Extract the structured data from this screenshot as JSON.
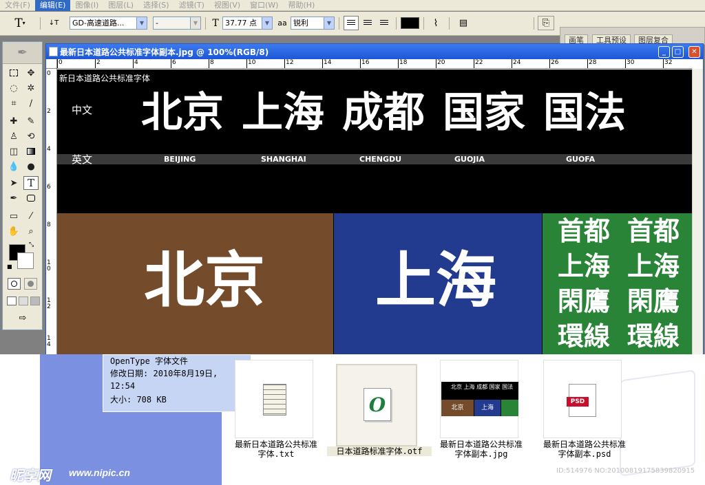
{
  "menubar": {
    "items": [
      "文件(F)",
      "编辑(E)",
      "图像(I)",
      "图层(L)",
      "选择(S)",
      "滤镜(T)",
      "视图(V)",
      "窗口(W)",
      "帮助(H)"
    ],
    "active_index": 1
  },
  "options_bar": {
    "tool_glyph": "T",
    "orient_glyph": "↓T",
    "font_family": "GD-高速道路...",
    "font_style": "-",
    "size_glyph": "T",
    "font_size": "37.77 点",
    "aa_glyph": "aa",
    "aa_mode": "锐利",
    "text_color": "#000000",
    "palette_tabs": [
      "画笔",
      "工具预设",
      "图层复合"
    ]
  },
  "document": {
    "title": "最新日本道路公共标准字体副本.jpg @ 100%(RGB/8)",
    "ruler_top": [
      "0",
      "2",
      "4",
      "6",
      "8",
      "10",
      "12",
      "14",
      "16",
      "18",
      "20",
      "22",
      "24",
      "26",
      "28",
      "30",
      "32"
    ],
    "ruler_left": [
      "0",
      "2",
      "4",
      "6",
      "8",
      "10",
      "12",
      "14"
    ]
  },
  "canvas": {
    "heading": "新日本道路公共标准字体",
    "label_cn": "中文",
    "label_en": "英文",
    "big_words": [
      "北京",
      "上海",
      "成都",
      "国家",
      "国法"
    ],
    "romaji": [
      "BEIJING",
      "SHANGHAI",
      "CHENGDU",
      "GUOJIA",
      "GUOFA"
    ],
    "sign_brown": "北京",
    "sign_blue": "上海",
    "sign_green": [
      "首都",
      "首都",
      "上海",
      "上海",
      "閑鷹",
      "閑鷹",
      "環線",
      "環線"
    ],
    "colors": {
      "brown": "#754c2b",
      "blue": "#233b8f",
      "green": "#2a8437",
      "strip": "#3a3a3a"
    }
  },
  "details": {
    "type": "OpenType 字体文件",
    "modified_label": "修改日期:",
    "modified_value": "2010年8月19日,",
    "modified_time": "12:54",
    "size": "大小: 708 KB"
  },
  "files": [
    {
      "name1": "最新日本道路公共标准",
      "name2": "字体.txt",
      "icon": "text-document-icon"
    },
    {
      "name1": "日本道路标准字体.otf",
      "name2": "",
      "icon": "opentype-font-icon"
    },
    {
      "name1": "最新日本道路公共标准",
      "name2": "字体副本.jpg",
      "icon": "image-thumbnail-icon"
    },
    {
      "name1": "最新日本道路公共标准",
      "name2": "字体副本.psd",
      "icon": "psd-file-icon"
    }
  ],
  "thumb_text": {
    "top": "北京 上海 成都 国家 国法",
    "left": "北京",
    "right": "上海",
    "psd": "PSD"
  },
  "watermark": {
    "logo": "昵享网",
    "site": "www.nipic.cn",
    "id": "ID:514976 NO:20100819175839820915"
  }
}
